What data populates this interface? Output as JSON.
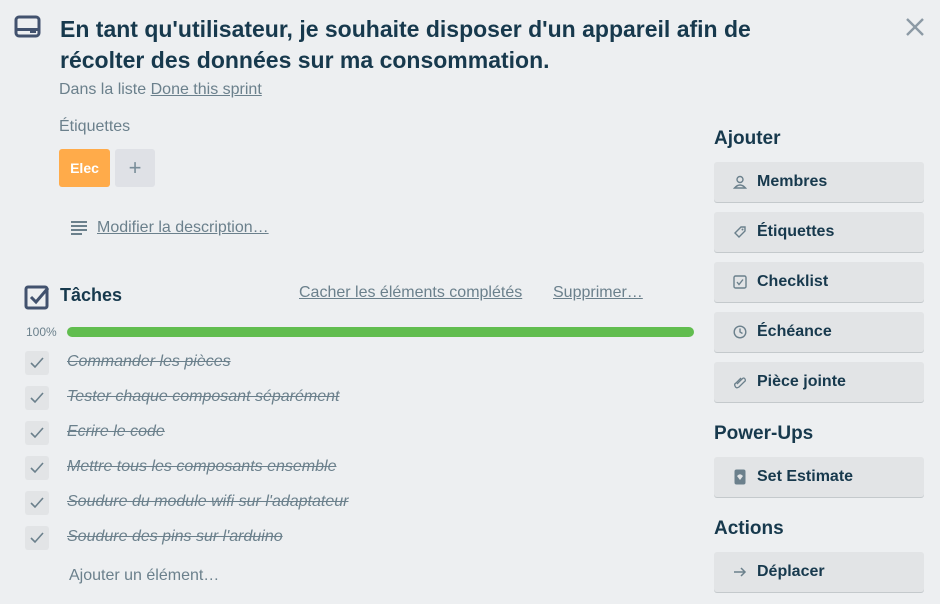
{
  "card": {
    "title": "En tant qu'utilisateur, je souhaite disposer d'un appareil afin de récolter des données sur ma consommation.",
    "in_list_prefix": "Dans la liste",
    "list_name": "Done this sprint",
    "icon": "card-icon"
  },
  "labels": {
    "title": "Étiquettes",
    "items": [
      {
        "name": "Elec",
        "color": "#ffab4a"
      }
    ],
    "add_symbol": "+"
  },
  "description": {
    "edit_label": "Modifier la description…"
  },
  "checklist": {
    "title": "Tâches",
    "hide_completed_label": "Cacher les éléments complétés",
    "delete_label": "Supprimer…",
    "progress_text": "100%",
    "progress": 1.0,
    "progress_color": "#61bd4f",
    "items": [
      {
        "text": "Commander les pièces",
        "done": true
      },
      {
        "text": "Tester chaque composant séparément",
        "done": true
      },
      {
        "text": "Ecrire le code",
        "done": true
      },
      {
        "text": "Mettre tous les composants ensemble",
        "done": true
      },
      {
        "text": "Soudure du module wifi sur l'adaptateur",
        "done": true
      },
      {
        "text": "Soudure des pins sur l'arduino",
        "done": true
      }
    ],
    "add_item_label": "Ajouter un élément…"
  },
  "sidebar": {
    "add_title": "Ajouter",
    "add_buttons": [
      {
        "label": "Membres",
        "icon": "person-icon"
      },
      {
        "label": "Étiquettes",
        "icon": "tag-icon"
      },
      {
        "label": "Checklist",
        "icon": "checkbox-icon"
      },
      {
        "label": "Échéance",
        "icon": "clock-icon"
      },
      {
        "label": "Pièce jointe",
        "icon": "paperclip-icon"
      }
    ],
    "powerups_title": "Power-Ups",
    "powerup_buttons": [
      {
        "label": "Set Estimate",
        "icon": "estimate-icon"
      }
    ],
    "actions_title": "Actions",
    "action_buttons": [
      {
        "label": "Déplacer",
        "icon": "arrow-right-icon"
      }
    ]
  }
}
